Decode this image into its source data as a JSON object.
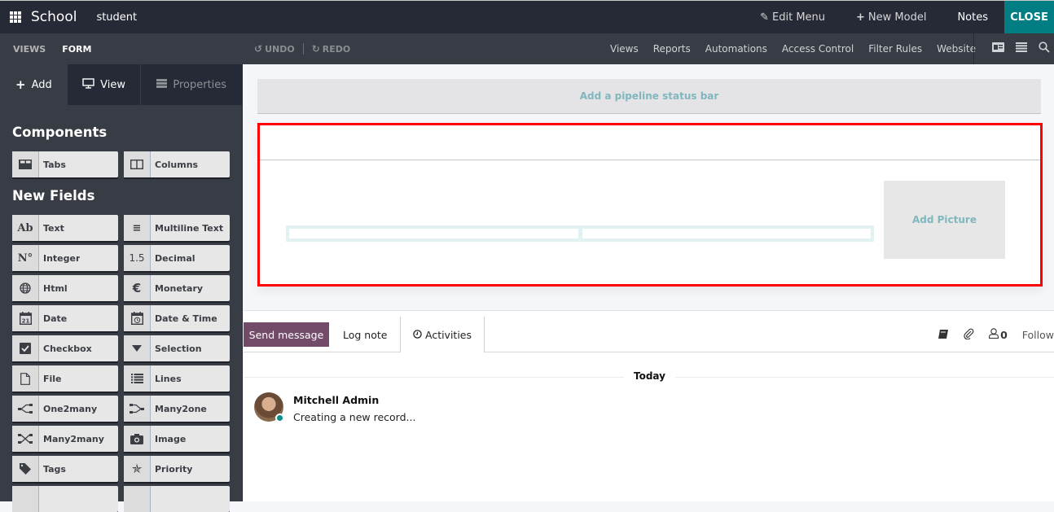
{
  "topbar": {
    "app_name": "School",
    "model_name": "student",
    "edit_menu": "Edit Menu",
    "new_model": "New Model",
    "notes": "Notes",
    "close": "CLOSE"
  },
  "subbar": {
    "breadcrumb": [
      "VIEWS",
      "FORM"
    ],
    "undo": "UNDO",
    "redo": "REDO",
    "nav": [
      "Views",
      "Reports",
      "Automations",
      "Access Control",
      "Filter Rules",
      "Website"
    ]
  },
  "sidebar": {
    "tabs": {
      "add": "Add",
      "view": "View",
      "properties": "Properties"
    },
    "components_title": "Components",
    "components": [
      {
        "label": "Tabs",
        "icon": "tabs-icon"
      },
      {
        "label": "Columns",
        "icon": "columns-icon"
      }
    ],
    "new_fields_title": "New Fields",
    "fields": [
      {
        "label": "Text",
        "icon": "Ab"
      },
      {
        "label": "Multiline Text",
        "icon": "≡"
      },
      {
        "label": "Integer",
        "icon": "N°"
      },
      {
        "label": "Decimal",
        "icon": "1.5"
      },
      {
        "label": "Html",
        "icon": "🌐"
      },
      {
        "label": "Monetary",
        "icon": "€"
      },
      {
        "label": "Date",
        "icon": "21"
      },
      {
        "label": "Date & Time",
        "icon": "◷"
      },
      {
        "label": "Checkbox",
        "icon": "☑"
      },
      {
        "label": "Selection",
        "icon": "▼"
      },
      {
        "label": "File",
        "icon": "🗋"
      },
      {
        "label": "Lines",
        "icon": "☰"
      },
      {
        "label": "One2many",
        "icon": "⊰"
      },
      {
        "label": "Many2one",
        "icon": "⊱"
      },
      {
        "label": "Many2many",
        "icon": "⤨"
      },
      {
        "label": "Image",
        "icon": "📷"
      },
      {
        "label": "Tags",
        "icon": "🏷"
      },
      {
        "label": "Priority",
        "icon": "✯"
      },
      {
        "label": "",
        "icon": ""
      },
      {
        "label": "",
        "icon": ""
      }
    ]
  },
  "form": {
    "pipeline_label": "Add a pipeline status bar",
    "add_picture": "Add Picture"
  },
  "chatter": {
    "send_message": "Send message",
    "log_note": "Log note",
    "activities": "Activities",
    "followers_count": "0",
    "follow": "Follow",
    "date_separator": "Today",
    "messages": [
      {
        "author": "Mitchell Admin",
        "text": "Creating a new record..."
      }
    ]
  }
}
